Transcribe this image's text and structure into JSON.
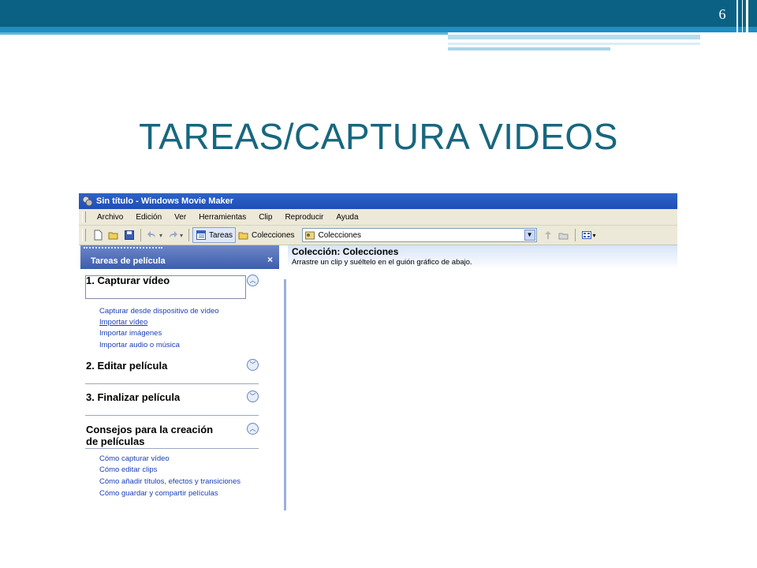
{
  "slide": {
    "number": "6",
    "title": "TAREAS/CAPTURA VIDEOS",
    "colors": {
      "header_dark": "#0b6183",
      "header_accent": "#1c8fc6",
      "title": "#17677f"
    }
  },
  "window": {
    "title": "Sin título - Windows Movie Maker",
    "menu": [
      "Archivo",
      "Edición",
      "Ver",
      "Herramientas",
      "Clip",
      "Reproducir",
      "Ayuda"
    ],
    "toolbar": {
      "tareas_label": "Tareas",
      "colecciones_label": "Colecciones",
      "collection_combo_value": "Colecciones",
      "icons": [
        "new-file-icon",
        "open-folder-icon",
        "save-icon",
        "undo-icon",
        "redo-icon",
        "tasks-icon",
        "collections-folder-icon",
        "up-folder-icon",
        "new-folder-icon",
        "views-icon"
      ]
    },
    "task_pane": {
      "title": "Tareas de película",
      "close_glyph": "×",
      "sections": [
        {
          "title": "1. Capturar vídeo",
          "expanded": true,
          "links": [
            "Capturar desde dispositivo de vídeo",
            "Importar vídeo",
            "Importar imágenes",
            "Importar audio o música"
          ]
        },
        {
          "title": "2. Editar película",
          "expanded": false,
          "links": []
        },
        {
          "title": "3. Finalizar película",
          "expanded": false,
          "links": []
        },
        {
          "title_line1": "Consejos para la creación",
          "title_line2": "de películas",
          "expanded": true,
          "links": [
            "Cómo capturar vídeo",
            "Cómo editar clips",
            "Cómo añadir títulos, efectos y transiciones",
            "Cómo guardar y compartir películas"
          ]
        }
      ]
    },
    "content": {
      "title": "Colección: Colecciones",
      "subtitle": "Arrastre un clip y suéltelo en el guión gráfico de abajo."
    }
  }
}
